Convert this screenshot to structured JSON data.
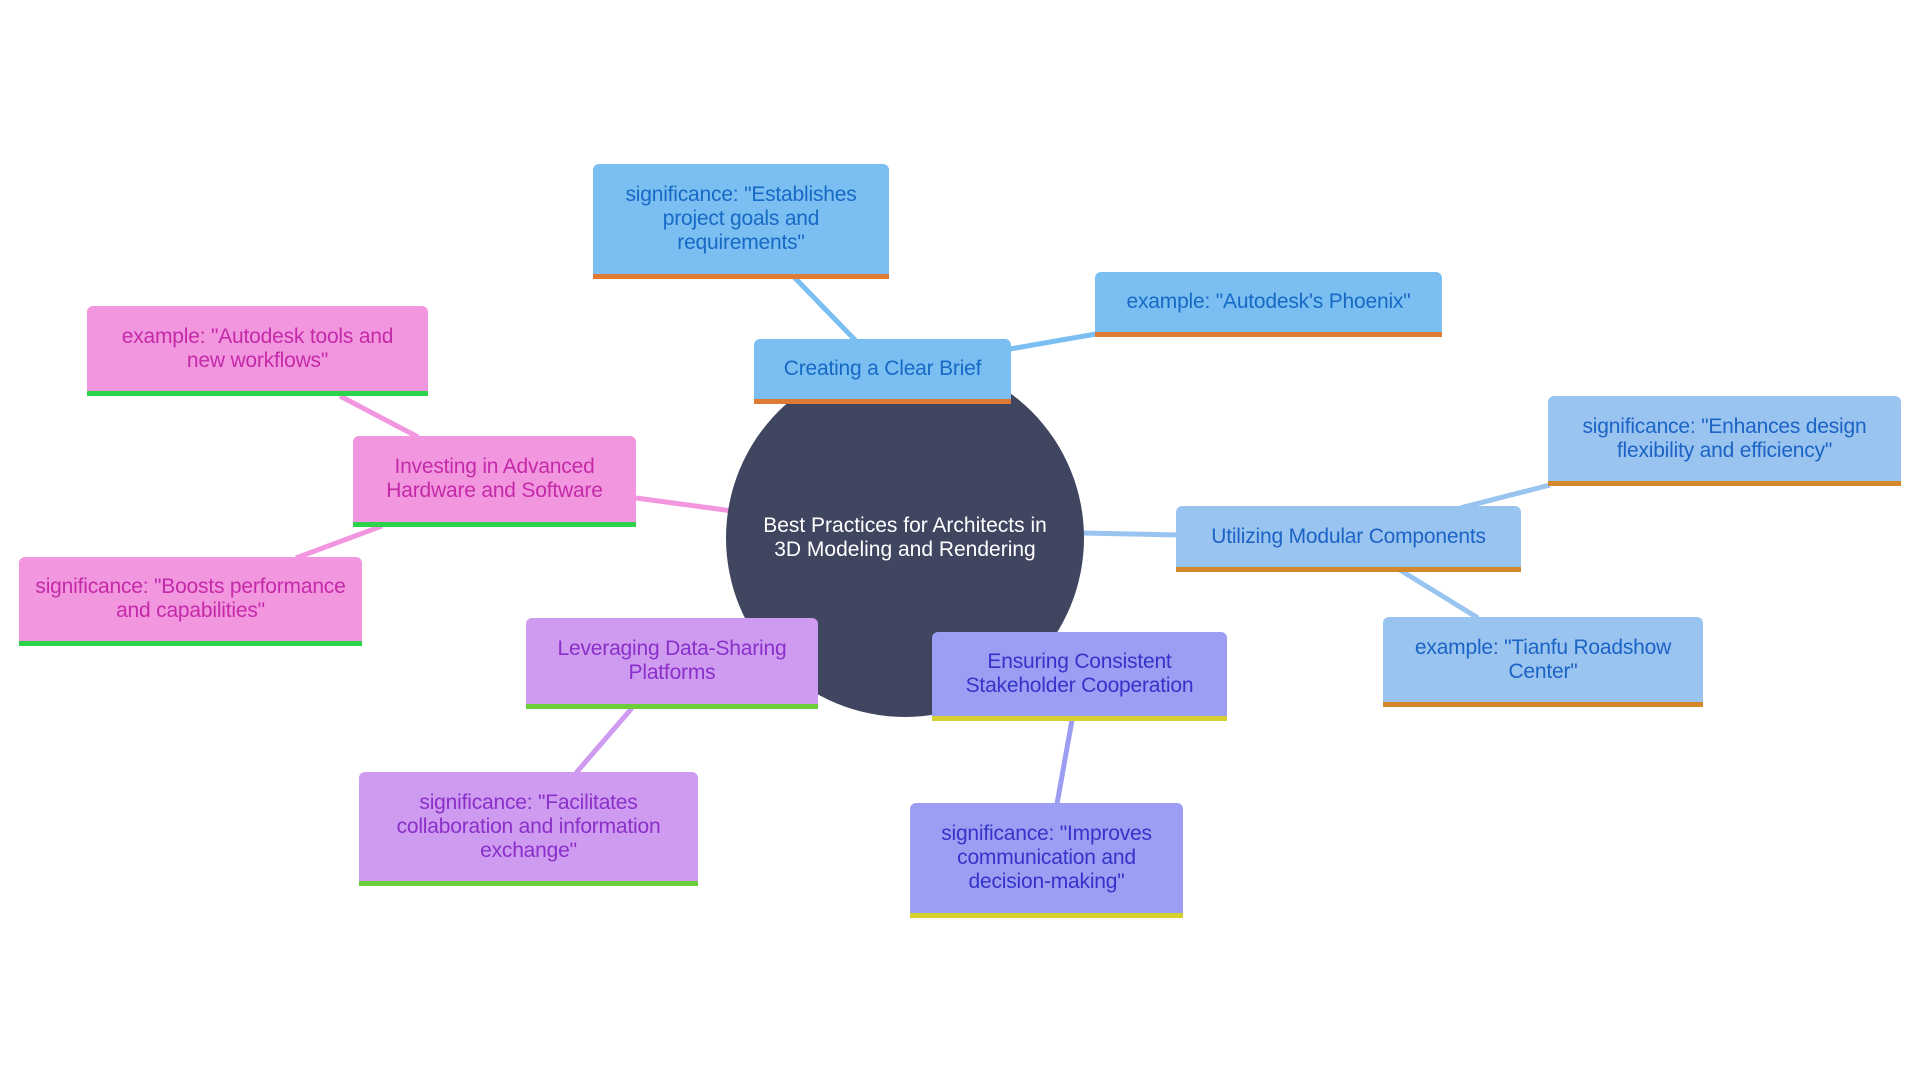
{
  "diagram": {
    "type": "mind-map",
    "root": {
      "id": "root",
      "label": "Best Practices for Architects in 3D Modeling and Rendering",
      "color": "#404560",
      "text_color": "#ffffff"
    },
    "branches": [
      {
        "id": "brief",
        "label": "Creating a Clear Brief",
        "theme": "blue",
        "colors": {
          "fill": "#7bbff2",
          "text": "#1669c4",
          "underline": "#e07b35",
          "edge": "#7bbff2"
        },
        "children": [
          {
            "id": "brief-sig",
            "label": "significance: \"Establishes project goals and requirements\""
          },
          {
            "id": "brief-ex",
            "label": "example: \"Autodesk's Phoenix\""
          }
        ]
      },
      {
        "id": "modular",
        "label": "Utilizing Modular Components",
        "theme": "light-blue",
        "colors": {
          "fill": "#9ac4f0",
          "text": "#1c63c6",
          "underline": "#d4862a",
          "edge": "#9ac4f0"
        },
        "children": [
          {
            "id": "modular-sig",
            "label": "significance: \"Enhances design flexibility and efficiency\""
          },
          {
            "id": "modular-ex",
            "label": "example: \"Tianfu Roadshow Center\""
          }
        ]
      },
      {
        "id": "stakeholder",
        "label": "Ensuring Consistent Stakeholder Cooperation",
        "theme": "violet",
        "colors": {
          "fill": "#9b9ef2",
          "text": "#3533c9",
          "underline": "#d6d02e",
          "edge": "#9b9ef2"
        },
        "children": [
          {
            "id": "stakeholder-sig",
            "label": "significance: \"Improves communication and decision-making\""
          }
        ]
      },
      {
        "id": "datasharing",
        "label": "Leveraging Data-Sharing Platforms",
        "theme": "purple",
        "colors": {
          "fill": "#cf9bf0",
          "text": "#8a2fc9",
          "underline": "#6ccf3a",
          "edge": "#cf9bf0"
        },
        "children": [
          {
            "id": "datasharing-sig",
            "label": "significance: \"Facilitates collaboration and information exchange\""
          }
        ]
      },
      {
        "id": "hardware",
        "label": "Investing in Advanced Hardware and Software",
        "theme": "pink",
        "colors": {
          "fill": "#f296e0",
          "text": "#c42aa8",
          "underline": "#2bd24a",
          "edge": "#f296e0"
        },
        "children": [
          {
            "id": "hardware-ex",
            "label": "example: \"Autodesk tools and new workflows\""
          },
          {
            "id": "hardware-sig",
            "label": "significance: \"Boosts performance and capabilities\""
          }
        ]
      }
    ]
  }
}
